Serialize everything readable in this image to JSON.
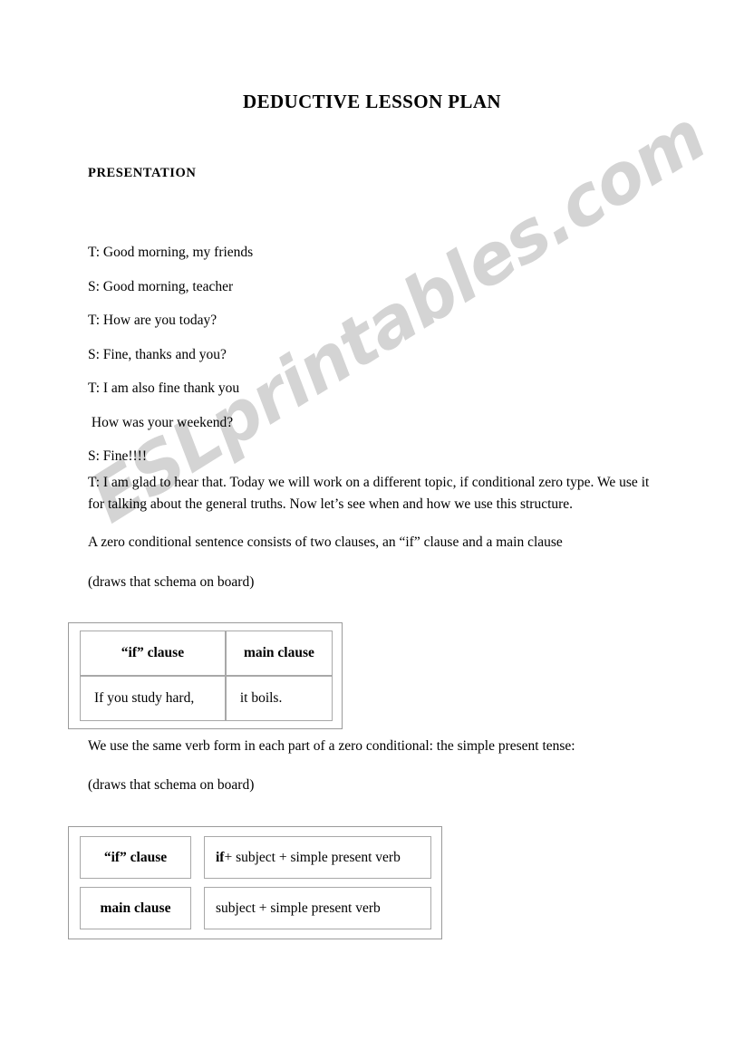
{
  "document": {
    "title": "DEDUCTIVE LESSON PLAN",
    "section_heading": "PRESENTATION"
  },
  "watermark": {
    "text": "ESLprintables.com",
    "color": "#d4d4d4"
  },
  "dialogue": [
    {
      "line": "T: Good morning, my friends"
    },
    {
      "line": "S: Good morning, teacher"
    },
    {
      "line": "T: How are you today?"
    },
    {
      "line": "S: Fine, thanks and you?"
    },
    {
      "line": "T: I am also fine thank you"
    },
    {
      "line": " How was your weekend?"
    },
    {
      "line": "S: Fine!!!!"
    }
  ],
  "body": {
    "para_1": "T: I am glad to hear that. Today we will work on a different topic, if conditional zero type. We use it for talking about the general truths. Now let’s see when and how we use this structure.",
    "para_2": "A zero conditional sentence consists of two clauses, an “if” clause and a main clause",
    "para_3": "(draws that schema on board)",
    "para_4": "We use the same verb form in each part of a zero conditional: the simple present tense:",
    "para_5": "(draws that schema on board)"
  },
  "table_1": {
    "header": {
      "col_1": "“if” clause",
      "col_2": "main clause"
    },
    "example": {
      "col_1": "If you study hard,",
      "col_2": "it boils."
    }
  },
  "table_2": {
    "rows": [
      {
        "label": "“if” clause",
        "value_bold": "if",
        "value_rest": " + subject + simple present verb"
      },
      {
        "label": "main clause",
        "value_bold": "",
        "value_rest": "subject + simple present verb"
      }
    ]
  }
}
